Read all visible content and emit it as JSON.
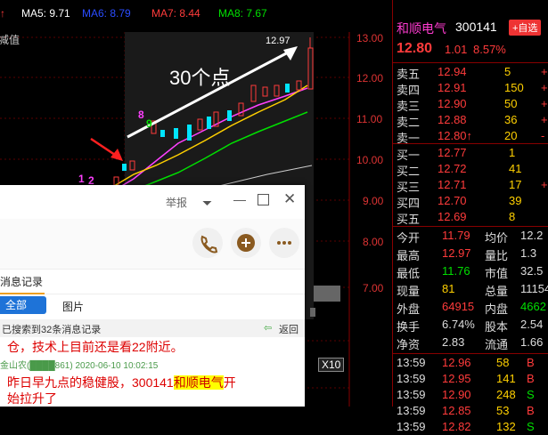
{
  "moving_averages": [
    {
      "label": "MA5: 9.71",
      "color": "#ffffff"
    },
    {
      "label": "MA6: 8.79",
      "color": "#2a4cff"
    },
    {
      "label": "MA7: 8.44",
      "color": "#ff3b3b"
    },
    {
      "label": "MA8: 7.67",
      "color": "#00e000"
    }
  ],
  "ma_up_arrow": "↑",
  "left_fragment": "减值",
  "chart": {
    "y_ticks": [
      "13.00",
      "12.00",
      "11.00",
      "10.00",
      "9.00",
      "8.00",
      "7.00"
    ],
    "annotation": "30个点",
    "peak_label": "12.97",
    "x10_label": "X10",
    "digit_labels": [
      "9",
      "8",
      "1",
      "2"
    ]
  },
  "quote": {
    "stock_name": "和顺电气",
    "stock_code": "300141",
    "add_button": "+自选",
    "price": "12.80",
    "change": "1.01",
    "change_pct": "8.57%",
    "sell_orders": [
      {
        "label": "卖五",
        "price": "12.94",
        "vol": "5",
        "extra": "+"
      },
      {
        "label": "卖四",
        "price": "12.91",
        "vol": "150",
        "extra": "+"
      },
      {
        "label": "卖三",
        "price": "12.90",
        "vol": "50",
        "extra": "+"
      },
      {
        "label": "卖二",
        "price": "12.88",
        "vol": "36",
        "extra": "+"
      },
      {
        "label": "卖一",
        "price": "12.80↑",
        "vol": "20",
        "extra": "-"
      }
    ],
    "buy_orders": [
      {
        "label": "买一",
        "price": "12.77",
        "vol": "1",
        "extra": ""
      },
      {
        "label": "买二",
        "price": "12.72",
        "vol": "41",
        "extra": ""
      },
      {
        "label": "买三",
        "price": "12.71",
        "vol": "17",
        "extra": "+"
      },
      {
        "label": "买四",
        "price": "12.70",
        "vol": "39",
        "extra": ""
      },
      {
        "label": "买五",
        "price": "12.69",
        "vol": "8",
        "extra": ""
      }
    ],
    "stats": [
      {
        "k1": "今开",
        "v1": "11.79",
        "k2": "均价",
        "v2": "12.2"
      },
      {
        "k1": "最高",
        "v1": "12.97",
        "k2": "量比",
        "v2": "1.3"
      },
      {
        "k1": "最低",
        "v1": "11.76",
        "k2": "市值",
        "v2": "32.5"
      },
      {
        "k1": "现量",
        "v1": "81",
        "k2": "总量",
        "v2": "11154"
      },
      {
        "k1": "外盘",
        "v1": "64915",
        "k2": "内盘",
        "v2": "4662"
      },
      {
        "k1": "换手",
        "v1": "6.74%",
        "k2": "股本",
        "v2": "2.54"
      },
      {
        "k1": "净资",
        "v1": "2.83",
        "k2": "流通",
        "v2": "1.66"
      }
    ],
    "ticks": [
      {
        "time": "13:59",
        "price": "12.96",
        "vol": "58",
        "dir": "B"
      },
      {
        "time": "13:59",
        "price": "12.95",
        "vol": "141",
        "dir": "B"
      },
      {
        "time": "13:59",
        "price": "12.90",
        "vol": "248",
        "dir": "S"
      },
      {
        "time": "13:59",
        "price": "12.85",
        "vol": "53",
        "dir": "B"
      },
      {
        "time": "13:59",
        "price": "12.82",
        "vol": "132",
        "dir": "S"
      }
    ]
  },
  "chat": {
    "report_label": "举报",
    "tab_history": "消息记录",
    "filter_all": "全部",
    "filter_images": "图片",
    "found_text": "已搜索到32条消息记录",
    "back_label": "返回",
    "msg1_partial": "仓，技术上目前还是看22附近。",
    "msg2_header": "金山农(████861) 2020-06-10 10:02:15",
    "msg2_before": "昨日早九点的稳健股，300141",
    "msg2_highlight": "和顺电气",
    "msg2_after": "开",
    "msg2_line2": "始拉升了"
  }
}
